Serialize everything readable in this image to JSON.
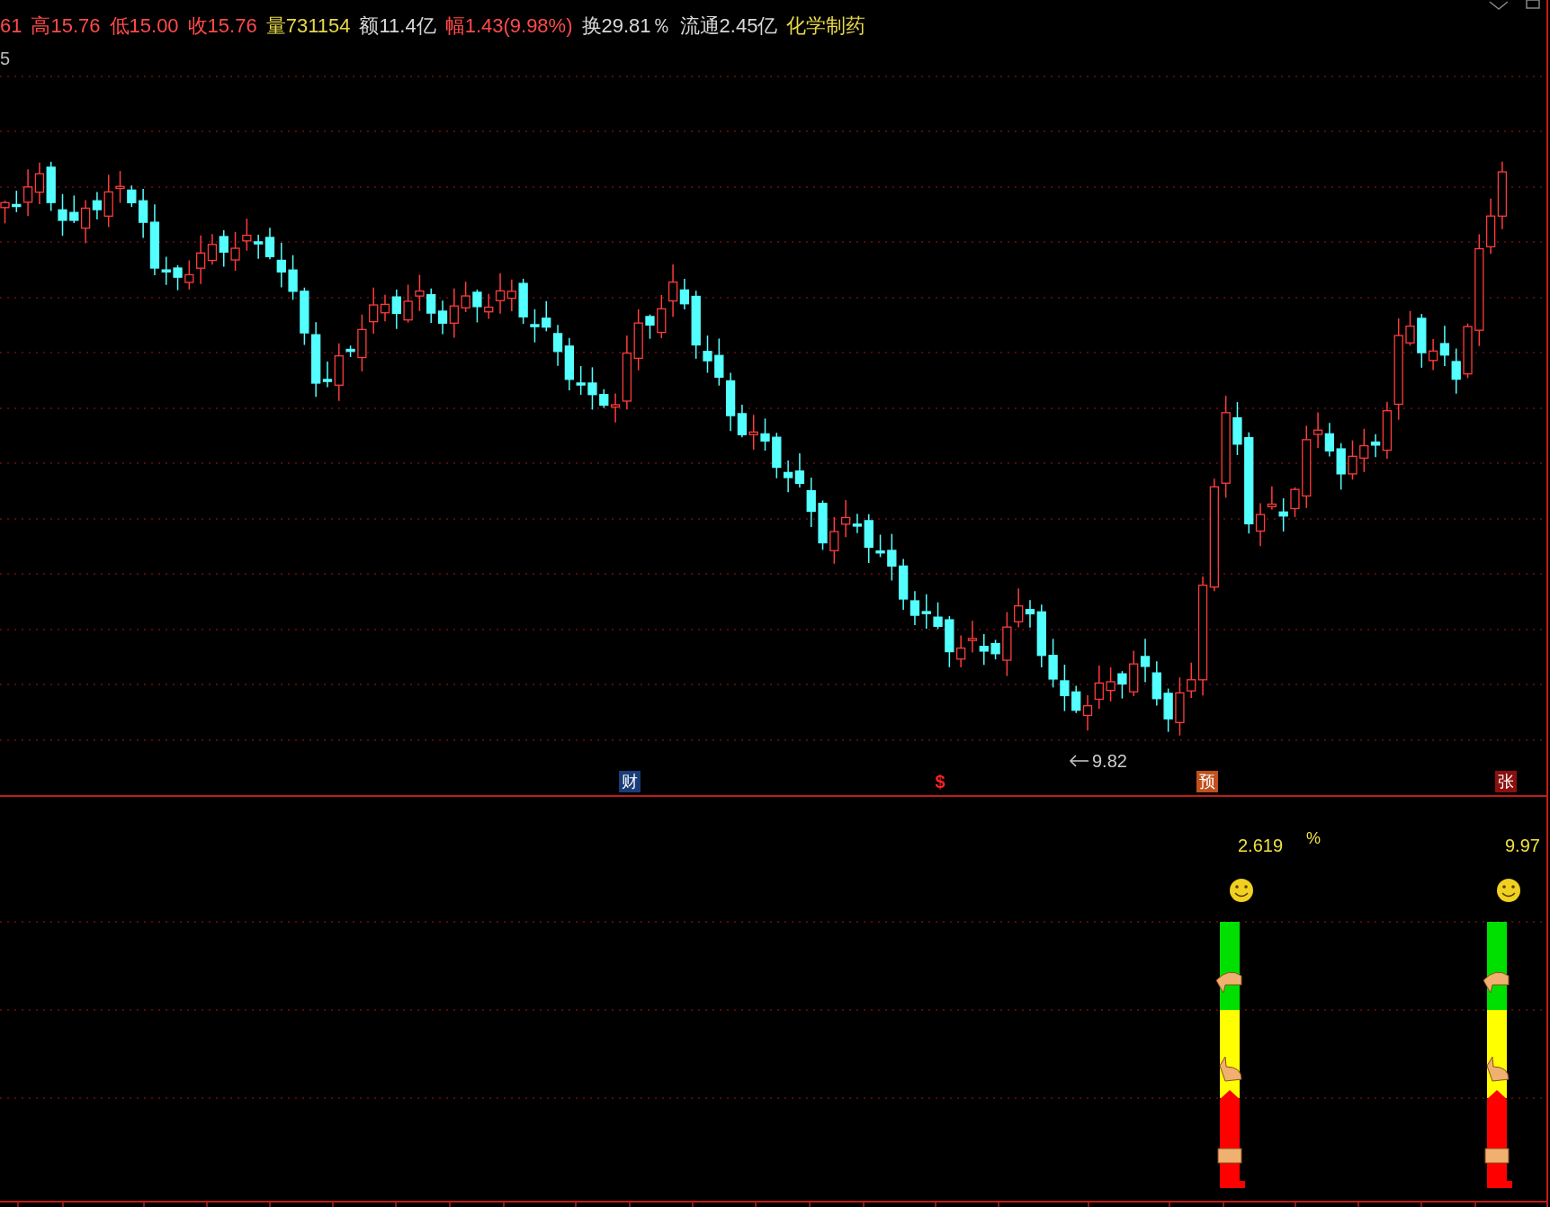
{
  "header": {
    "items": [
      {
        "text": "61",
        "color": "#ff4a4a"
      },
      {
        "text": "高15.76",
        "color": "#ff4a4a"
      },
      {
        "text": "低15.00",
        "color": "#ff4a4a"
      },
      {
        "text": "收15.76",
        "color": "#ff4a4a"
      },
      {
        "text": "量731154",
        "color": "#e8d84a"
      },
      {
        "text": "额11.4亿",
        "color": "#d8d8d8"
      },
      {
        "text": "幅1.43(9.98%)",
        "color": "#ff4a4a"
      },
      {
        "text": "换29.81％",
        "color": "#d8d8d8"
      },
      {
        "text": "流通2.45亿",
        "color": "#d8d8d8"
      },
      {
        "text": "化学制药",
        "color": "#e8d84a"
      }
    ],
    "second_line": "5"
  },
  "main_chart": {
    "low_label": "9.82",
    "markers": [
      {
        "text": "财",
        "kind": "finance"
      },
      {
        "text": "$",
        "kind": "dollar"
      },
      {
        "text": "预",
        "kind": "forecast"
      },
      {
        "text": "张",
        "kind": "limit"
      }
    ]
  },
  "indicator": {
    "columns": [
      {
        "value": "2.619",
        "unit": "%"
      },
      {
        "value": "9.97"
      }
    ]
  }
}
